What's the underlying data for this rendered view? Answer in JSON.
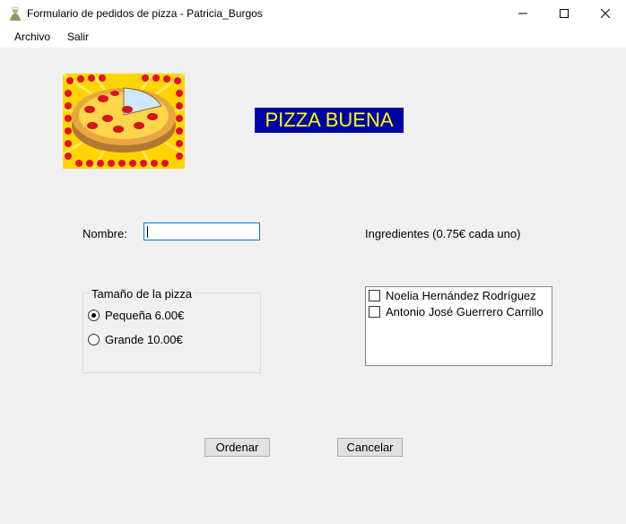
{
  "window": {
    "title": "Formulario de pedidos de pizza - Patricia_Burgos",
    "app_icon": "pizza-cook-icon",
    "minimize_icon": "minimize-icon",
    "maximize_icon": "maximize-icon",
    "close_icon": "close-icon"
  },
  "menu": {
    "items": [
      "Archivo",
      "Salir"
    ]
  },
  "header": {
    "brand_text": "PIZZA BUENA",
    "brand_bg": "#0000a8",
    "brand_fg": "#ffff00"
  },
  "form": {
    "name_label": "Nombre:",
    "name_value": "",
    "ingredients_label": "Ingredientes (0.75€ cada uno)"
  },
  "size_group": {
    "legend": "Tamaño de la pizza",
    "options": [
      {
        "label": "Pequeña 6.00€",
        "checked": true
      },
      {
        "label": "Grande 10.00€",
        "checked": false
      }
    ]
  },
  "ingredients": {
    "items": [
      {
        "label": "Noelia Hernández Rodríguez",
        "checked": false
      },
      {
        "label": "Antonio José Guerrero Carrillo",
        "checked": false
      }
    ]
  },
  "buttons": {
    "order": "Ordenar",
    "cancel": "Cancelar"
  }
}
